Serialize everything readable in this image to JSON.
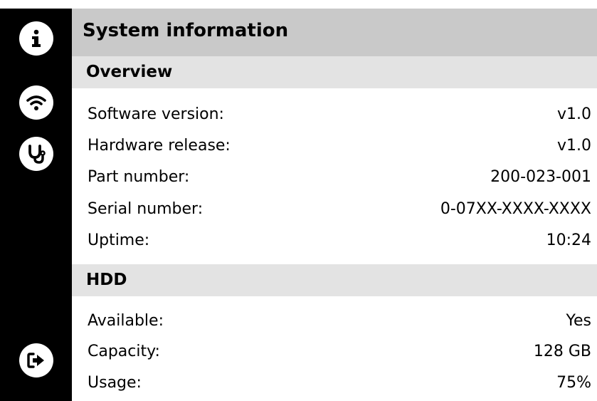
{
  "title": "System information",
  "sidebar": {
    "items": [
      {
        "icon": "info-icon"
      },
      {
        "icon": "wifi-icon"
      },
      {
        "icon": "stethoscope-icon"
      },
      {
        "icon": "logout-icon"
      }
    ]
  },
  "overview": {
    "header": "Overview",
    "rows": [
      {
        "label": "Software version:",
        "value": "v1.0"
      },
      {
        "label": "Hardware release:",
        "value": "v1.0"
      },
      {
        "label": "Part number:",
        "value": "200-023-001"
      },
      {
        "label": "Serial number:",
        "value": "0-07XX-XXXX-XXXX"
      },
      {
        "label": "Uptime:",
        "value": "10:24"
      }
    ]
  },
  "hdd": {
    "header": "HDD",
    "rows": [
      {
        "label": "Available:",
        "value": "Yes"
      },
      {
        "label": "Capacity:",
        "value": "128 GB"
      },
      {
        "label": "Usage:",
        "value": "75%"
      }
    ]
  },
  "colors": {
    "sidebar": "#000000",
    "title_bar": "#c9c9c9",
    "section_header": "#e3e3e3"
  }
}
